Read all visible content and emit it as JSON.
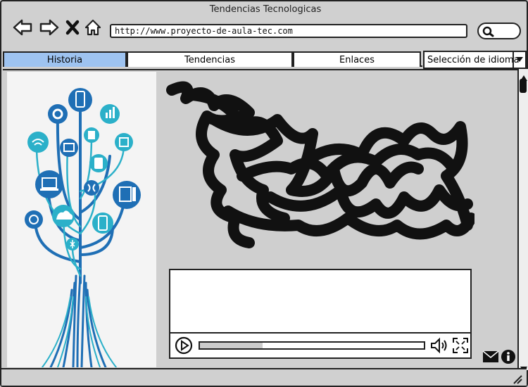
{
  "window": {
    "title": "Tendencias Tecnologicas"
  },
  "toolbar": {
    "back_icon": "arrow-left-icon",
    "forward_icon": "arrow-right-icon",
    "close_icon": "x-icon",
    "home_icon": "home-icon",
    "url": "http://www.proyecto-de-aula-tec.com",
    "search_icon": "search-icon"
  },
  "tabs": [
    {
      "label": "Historia",
      "active": true
    },
    {
      "label": "Tendencias",
      "active": false
    },
    {
      "label": "Enlaces",
      "active": false
    }
  ],
  "language": {
    "label": "Selección de idioma"
  },
  "content": {
    "image": "technology-tree-illustration",
    "text_placeholder": "scribbled-text-block",
    "video": {
      "play_icon": "play-icon",
      "progress": 0.28,
      "volume_icon": "volume-icon",
      "fullscreen_icon": "fullscreen-icon"
    }
  },
  "footer": {
    "mail_icon": "mail-icon",
    "info_icon": "info-icon"
  },
  "colors": {
    "active_tab": "#9ec3f0",
    "tree_blue": "#1f6fb5",
    "tree_teal": "#2bb0c9"
  }
}
